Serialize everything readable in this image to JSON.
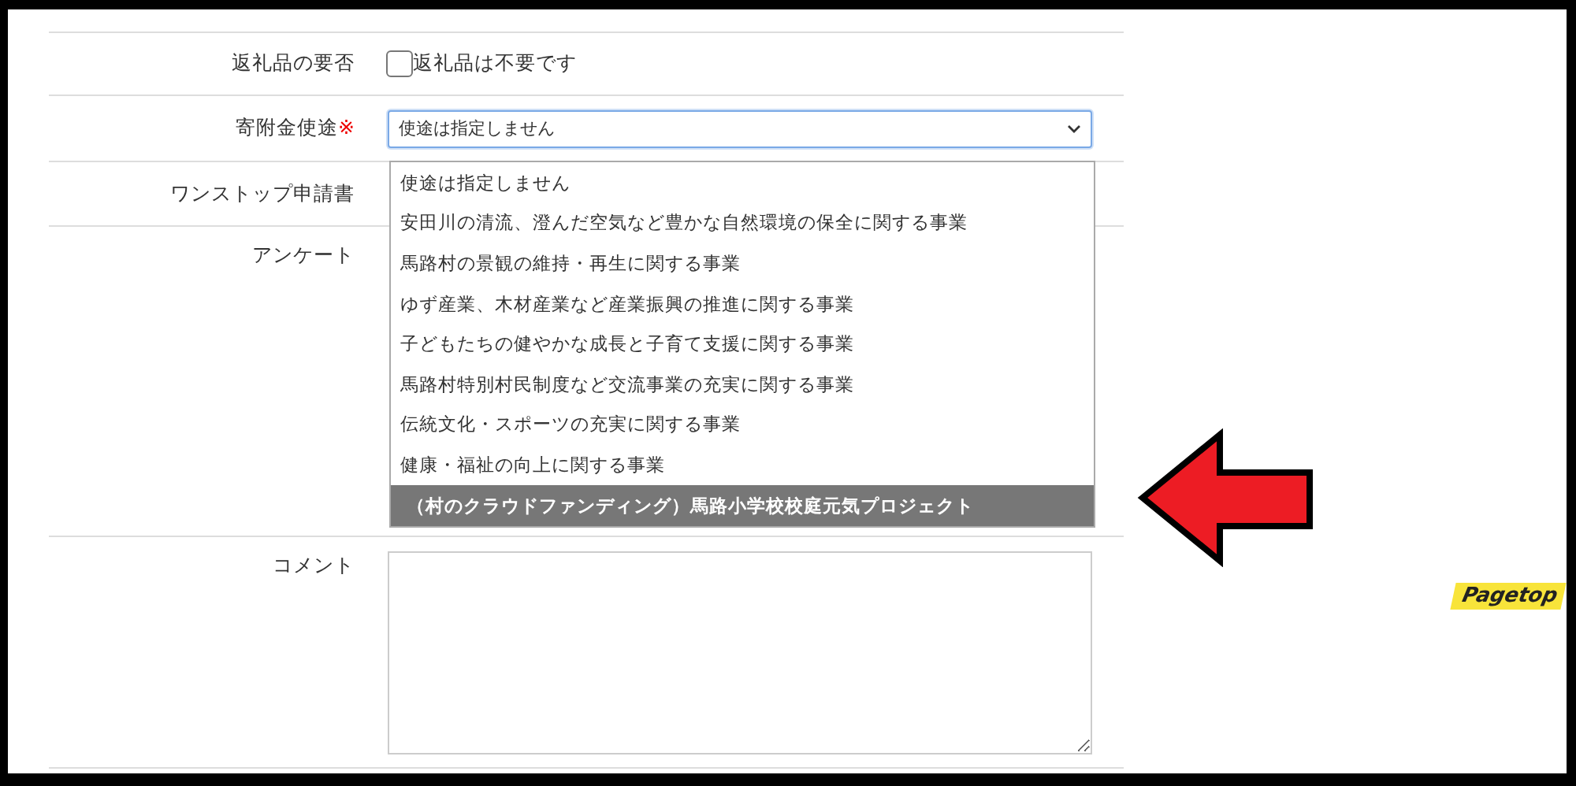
{
  "form": {
    "rows": [
      {
        "kind": "checkbox",
        "label": "返礼品の要否",
        "checkbox": {
          "label": "返礼品は不要です",
          "checked": false
        }
      },
      {
        "kind": "select",
        "label": "寄附金使途",
        "required_mark": "※",
        "value": "使途は指定しません",
        "expanded": true,
        "options": [
          {
            "label": "使途は指定しません",
            "highlighted": false
          },
          {
            "label": "安田川の清流、澄んだ空気など豊かな自然環境の保全に関する事業",
            "highlighted": false
          },
          {
            "label": "馬路村の景観の維持・再生に関する事業",
            "highlighted": false
          },
          {
            "label": "ゆず産業、木材産業など産業振興の推進に関する事業",
            "highlighted": false
          },
          {
            "label": "子どもたちの健やかな成長と子育て支援に関する事業",
            "highlighted": false
          },
          {
            "label": "馬路村特別村民制度など交流事業の充実に関する事業",
            "highlighted": false
          },
          {
            "label": "伝統文化・スポーツの充実に関する事業",
            "highlighted": false
          },
          {
            "label": "健康・福祉の向上に関する事業",
            "highlighted": false
          },
          {
            "label": "（村のクラウドファンディング）馬路小学校校庭元気プロジェクト",
            "highlighted": true
          }
        ]
      },
      {
        "kind": "label_only",
        "label": "ワンストップ申請書"
      },
      {
        "kind": "label_only",
        "label": "アンケート"
      },
      {
        "kind": "textarea",
        "label": "コメント"
      }
    ]
  },
  "pagetop": "Pagetop"
}
